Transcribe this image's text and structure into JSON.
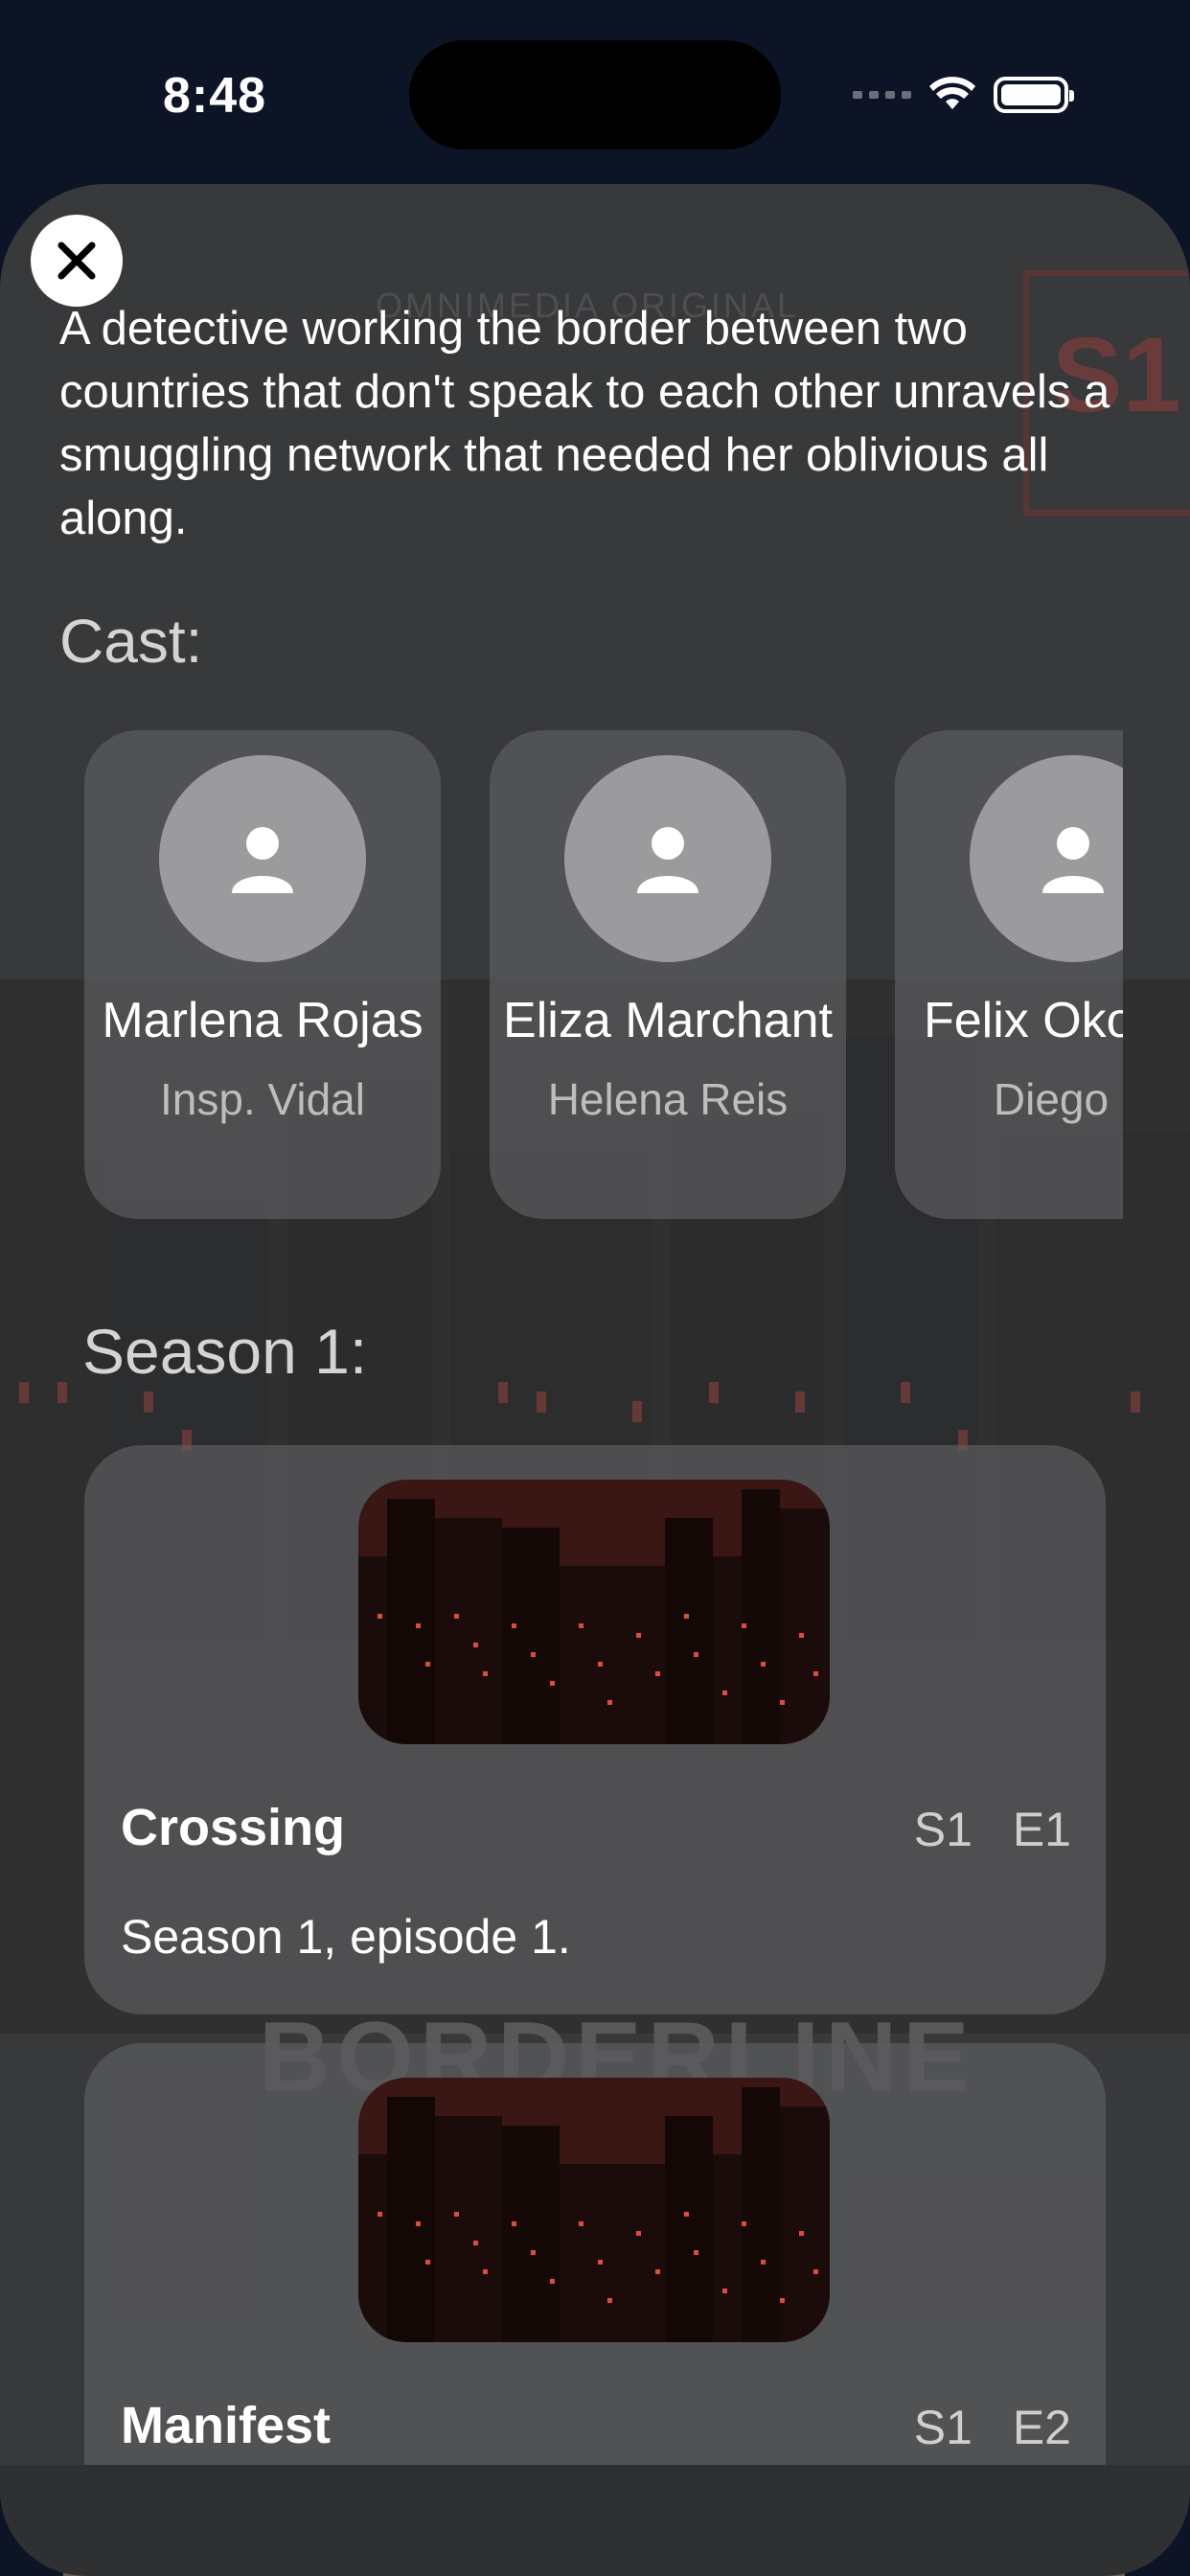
{
  "status_bar": {
    "time": "8:48"
  },
  "background": {
    "brand": "OMNIMEDIA ORIGINAL",
    "badge": "S1",
    "show_title": "BORDERLINE"
  },
  "synopsis": "A detective working the border between two countries that don't speak to each other unravels a smuggling network that needed her oblivious all along.",
  "cast_label": "Cast:",
  "cast": [
    {
      "name": "Marlena Rojas",
      "role": "Insp. Vidal"
    },
    {
      "name": "Eliza Marchant",
      "role": "Helena Reis"
    },
    {
      "name": "Felix Okonkw",
      "role": "Diego R"
    }
  ],
  "season_label": "Season 1:",
  "episodes": [
    {
      "title": "Crossing",
      "code": "S1 E1",
      "description": "Season 1, episode 1."
    },
    {
      "title": "Manifest",
      "code": "S1 E2",
      "description": ""
    }
  ],
  "colors": {
    "accent_red": "#e04a3a",
    "sheet": "#38393a",
    "card": "#5c5c5e"
  }
}
